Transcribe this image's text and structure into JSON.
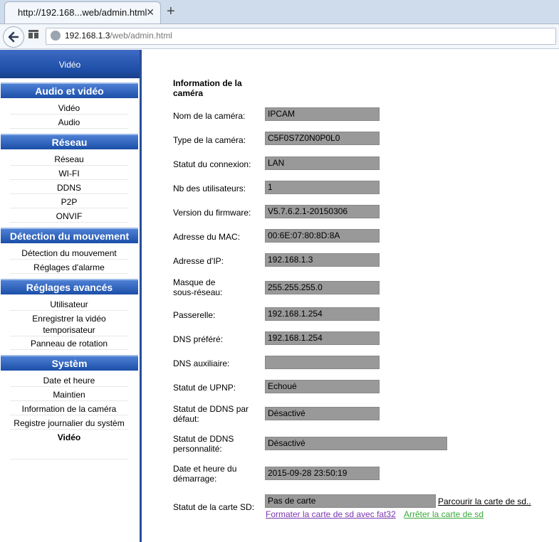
{
  "browser": {
    "tab_title": "http://192.168...web/admin.html",
    "tab_close": "✕",
    "new_tab": "+",
    "url_host": "192.168.1.3",
    "url_path": "/web/admin.html"
  },
  "sidebar": {
    "banner": "Vidéo",
    "sections": [
      {
        "title": "Audio et vidéo",
        "items": [
          "Vidéo",
          "Audio"
        ]
      },
      {
        "title": "Réseau",
        "items": [
          "Réseau",
          "WI-FI",
          "DDNS",
          "P2P",
          "ONVIF"
        ]
      },
      {
        "title": "Détection du mouvement",
        "items": [
          "Détection du mouvement",
          "Réglages d'alarme"
        ]
      },
      {
        "title": "Réglages avancés",
        "items": [
          "Utilisateur",
          "Enregistrer la vidéo temporisateur",
          "Panneau de rotation"
        ]
      },
      {
        "title": "Systèm",
        "items": [
          "Date et heure",
          "Maintien",
          "Information de la caméra",
          "Registre journalier du systèm",
          "Vidéo"
        ]
      }
    ]
  },
  "main": {
    "heading": "Information de la caméra",
    "fields": [
      {
        "label": "Nom de la caméra:",
        "value": "IPCAM"
      },
      {
        "label": "Type de la caméra:",
        "value": "C5F0S7Z0N0P0L0"
      },
      {
        "label": "Statut du connexion:",
        "value": "LAN"
      },
      {
        "label": "Nb des utilisateurs:",
        "value": "1"
      },
      {
        "label": "Version du firmware:",
        "value": "V5.7.6.2.1-20150306"
      },
      {
        "label": "Adresse du MAC:",
        "value": "00:6E:07:80:8D:8A"
      },
      {
        "label": "Adresse d'IP:",
        "value": "192.168.1.3"
      },
      {
        "label": "Masque de sous-réseau:",
        "value": "255.255.255.0"
      },
      {
        "label": "Passerelle:",
        "value": "192.168.1.254"
      },
      {
        "label": "DNS préféré:",
        "value": "192.168.1.254"
      },
      {
        "label": "DNS auxiliaire:",
        "value": ""
      },
      {
        "label": "Statut de UPNP:",
        "value": "Echoué"
      },
      {
        "label": "Statut de DDNS par défaut:",
        "value": "Désactivé"
      },
      {
        "label": "Statut de DDNS personnalité:",
        "value": "Désactivé"
      },
      {
        "label": "Date et heure du démarrage:",
        "value": "2015-09-28 23:50:19"
      },
      {
        "label": "Statut de la carte SD:",
        "value": "Pas de carte"
      }
    ],
    "links": {
      "browse": "Parcourir la carte de sd..",
      "format": "Formater la carte de sd avec fat32",
      "stop": "Arrêter la carte de sd"
    }
  }
}
